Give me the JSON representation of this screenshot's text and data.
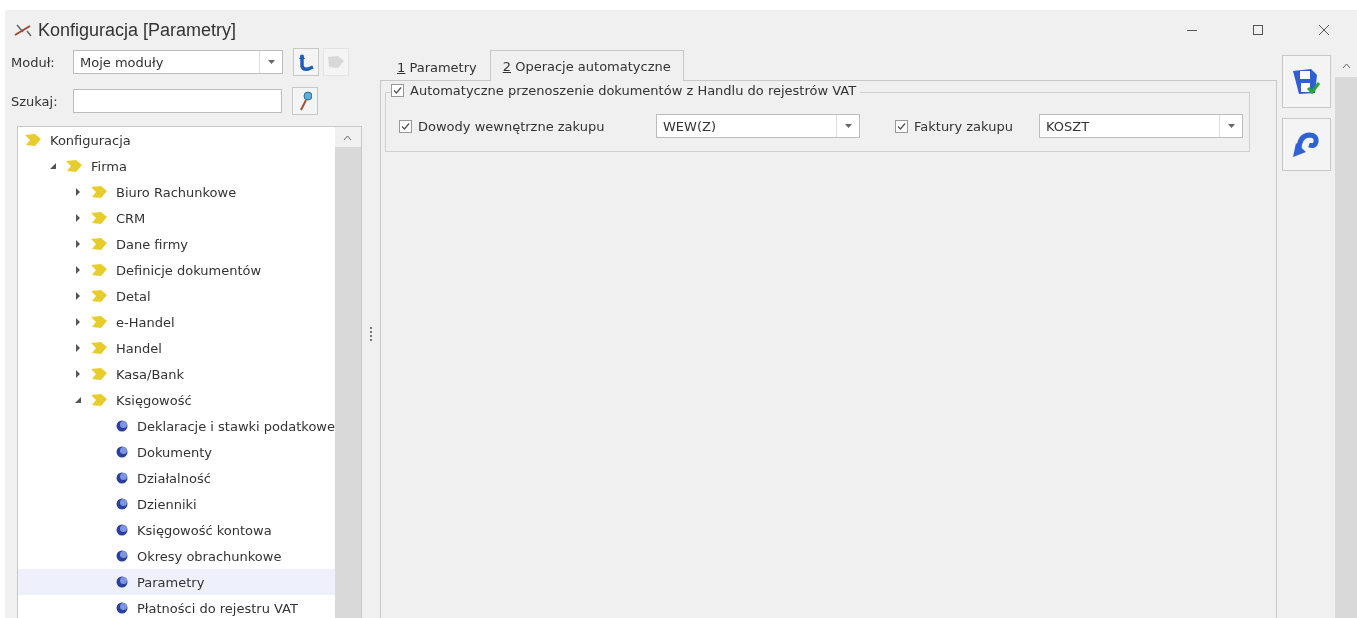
{
  "window": {
    "title": "Konfiguracja [Parametry]"
  },
  "module": {
    "label": "Moduł:",
    "value": "Moje moduły"
  },
  "search": {
    "label": "Szukaj:"
  },
  "tree": [
    {
      "label": "Konfiguracja",
      "kind": "folder",
      "expanded": true,
      "selected": false,
      "children": [
        {
          "label": "Firma",
          "kind": "folder",
          "expanded": true,
          "selected": false,
          "children": [
            {
              "label": "Biuro Rachunkowe",
              "kind": "folder",
              "expanded": false,
              "selected": false
            },
            {
              "label": "CRM",
              "kind": "folder",
              "expanded": false,
              "selected": false
            },
            {
              "label": "Dane firmy",
              "kind": "folder",
              "expanded": false,
              "selected": false
            },
            {
              "label": "Definicje dokumentów",
              "kind": "folder",
              "expanded": false,
              "selected": false
            },
            {
              "label": "Detal",
              "kind": "folder",
              "expanded": false,
              "selected": false
            },
            {
              "label": "e-Handel",
              "kind": "folder",
              "expanded": false,
              "selected": false
            },
            {
              "label": "Handel",
              "kind": "folder",
              "expanded": false,
              "selected": false
            },
            {
              "label": "Kasa/Bank",
              "kind": "folder",
              "expanded": false,
              "selected": false
            },
            {
              "label": "Księgowość",
              "kind": "folder",
              "expanded": true,
              "selected": false,
              "children": [
                {
                  "label": "Deklaracje i stawki podatkowe",
                  "kind": "leaf",
                  "selected": false
                },
                {
                  "label": "Dokumenty",
                  "kind": "leaf",
                  "selected": false
                },
                {
                  "label": "Działalność",
                  "kind": "leaf",
                  "selected": false
                },
                {
                  "label": "Dzienniki",
                  "kind": "leaf",
                  "selected": false
                },
                {
                  "label": "Księgowość kontowa",
                  "kind": "leaf",
                  "selected": false
                },
                {
                  "label": "Okresy obrachunkowe",
                  "kind": "leaf",
                  "selected": false
                },
                {
                  "label": "Parametry",
                  "kind": "leaf",
                  "selected": true
                },
                {
                  "label": "Płatności do rejestru VAT",
                  "kind": "leaf",
                  "selected": false
                }
              ]
            }
          ]
        }
      ]
    }
  ],
  "tabs": [
    {
      "key": "1",
      "label": " Parametry",
      "selected": false
    },
    {
      "key": "2",
      "label": " Operacje automatyczne",
      "selected": true
    }
  ],
  "group": {
    "label": "Automatyczne przenoszenie dokumentów z Handlu do rejestrów VAT",
    "checked": true,
    "fields": [
      {
        "label": "Dowody wewnętrzne zakupu",
        "checked": true,
        "value": "WEW(Z)"
      },
      {
        "label": "Faktury zakupu",
        "checked": true,
        "value": "KOSZT"
      }
    ]
  }
}
